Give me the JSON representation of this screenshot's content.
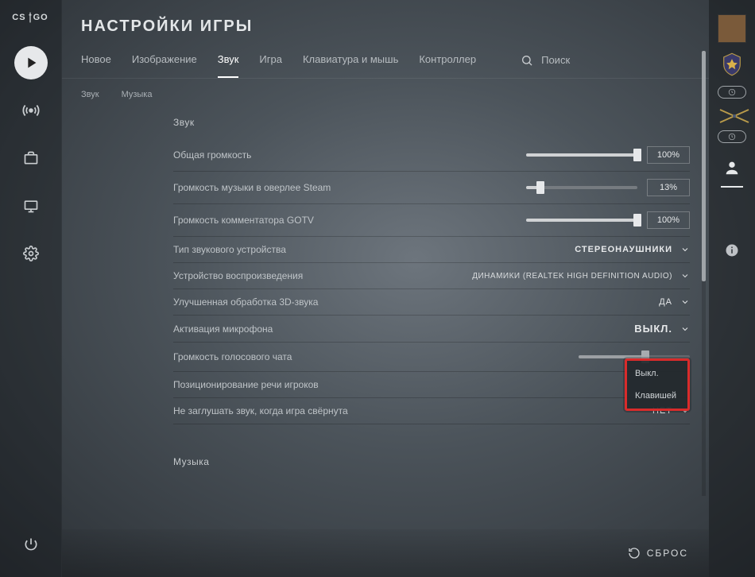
{
  "title": "НАСТРОЙКИ ИГРЫ",
  "logo": "CS   GO",
  "tabs": [
    "Новое",
    "Изображение",
    "Звук",
    "Игра",
    "Клавиатура и мышь",
    "Контроллер"
  ],
  "activeTabIndex": 2,
  "searchLabel": "Поиск",
  "subtabs": [
    "Звук",
    "Музыка"
  ],
  "section": {
    "header": "Звук",
    "rows": [
      {
        "label": "Общая громкость",
        "slider": 100,
        "value": "100%"
      },
      {
        "label": "Громкость музыки в оверлее Steam",
        "slider": 13,
        "value": "13%"
      },
      {
        "label": "Громкость комментатора GOTV",
        "slider": 100,
        "value": "100%"
      },
      {
        "label": "Тип звукового устройства",
        "dropdown": "СТЕРЕОНАУШНИКИ"
      },
      {
        "label": "Устройство воспроизведения",
        "dropdown": "ДИНАМИКИ (REALTEK HIGH DEFINITION AUDIO)",
        "small": true
      },
      {
        "label": "Улучшенная обработка 3D-звука",
        "dropdown": "ДА"
      },
      {
        "label": "Активация микрофона",
        "dropdown": "ВЫКЛ.",
        "bold": true
      },
      {
        "label": "Громкость голосового чата",
        "slider": 60,
        "ghost": true
      },
      {
        "label": "Позиционирование речи игроков"
      },
      {
        "label": "Не заглушать звук, когда игра свёрнута",
        "dropdown": "НЕТ"
      }
    ]
  },
  "section2": "Музыка",
  "popupOptions": [
    "Выкл.",
    "Клавишей"
  ],
  "footer": "СБРОС"
}
